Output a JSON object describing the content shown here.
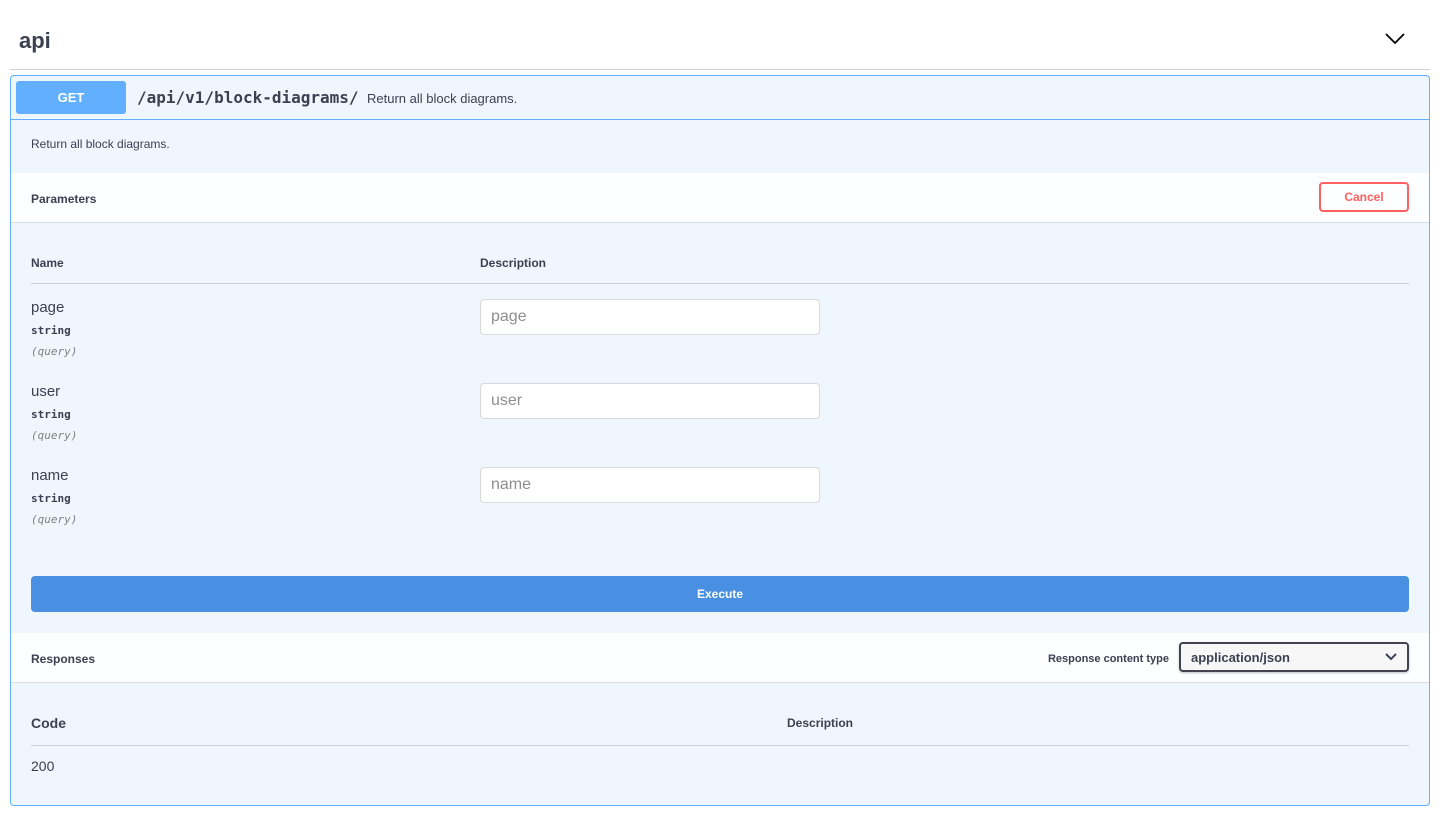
{
  "tag": {
    "title": "api",
    "toggle_icon": "chevron-down-icon"
  },
  "operation": {
    "method": "GET",
    "path": "/api/v1/block-diagrams/",
    "summary": "Return all block diagrams.",
    "description": "Return all block diagrams.",
    "colors": {
      "method": "#61affe",
      "background": "#eff6fd",
      "execute": "#4990e2",
      "cancel": "#ff6060"
    }
  },
  "parameters": {
    "title": "Parameters",
    "cancel_label": "Cancel",
    "name_header": "Name",
    "description_header": "Description",
    "items": [
      {
        "name": "page",
        "type": "string",
        "in": "(query)",
        "placeholder": "page"
      },
      {
        "name": "user",
        "type": "string",
        "in": "(query)",
        "placeholder": "user"
      },
      {
        "name": "name",
        "type": "string",
        "in": "(query)",
        "placeholder": "name"
      }
    ],
    "execute_label": "Execute"
  },
  "responses": {
    "title": "Responses",
    "content_type_label": "Response content type",
    "content_type_value": "application/json",
    "code_header": "Code",
    "description_header": "Description",
    "rows": [
      {
        "code": "200"
      }
    ]
  }
}
